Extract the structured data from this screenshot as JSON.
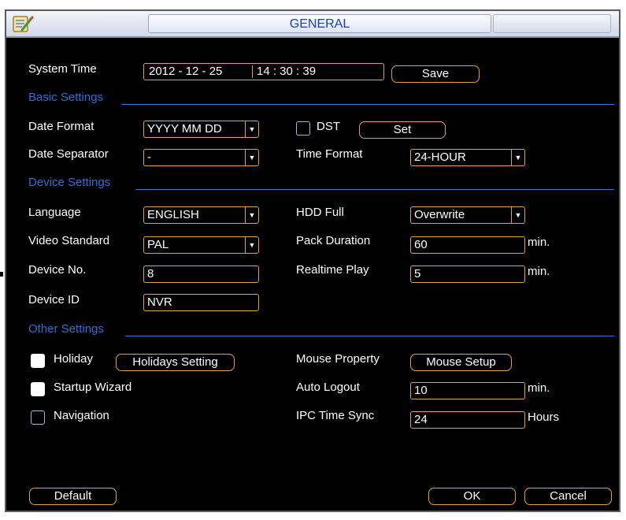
{
  "title": "GENERAL",
  "system_time": {
    "label": "System Time",
    "date_value": "2012  - 12 - 25",
    "time_value": "14 : 30 : 39",
    "save_label": "Save"
  },
  "sections": {
    "basic": "Basic Settings",
    "device": "Device Settings",
    "other": "Other Settings"
  },
  "date_format": {
    "label": "Date Format",
    "value": "YYYY MM DD"
  },
  "dst": {
    "label": "DST",
    "checked": false,
    "set_label": "Set"
  },
  "date_separator": {
    "label": "Date Separator",
    "value": "-"
  },
  "time_format": {
    "label": "Time Format",
    "value": "24-HOUR"
  },
  "language": {
    "label": "Language",
    "value": "ENGLISH"
  },
  "hdd_full": {
    "label": "HDD Full",
    "value": "Overwrite"
  },
  "video_standard": {
    "label": "Video Standard",
    "value": "PAL"
  },
  "pack_duration": {
    "label": "Pack Duration",
    "value": "60",
    "unit": "min."
  },
  "device_no": {
    "label": "Device No.",
    "value": "8"
  },
  "realtime_play": {
    "label": "Realtime Play",
    "value": "5",
    "unit": "min."
  },
  "device_id": {
    "label": "Device ID",
    "value": "NVR"
  },
  "holiday": {
    "label": "Holiday",
    "checked": true,
    "button_label": "Holidays Setting"
  },
  "mouse_property": {
    "label": "Mouse Property",
    "button_label": "Mouse Setup"
  },
  "startup_wizard": {
    "label": "Startup Wizard",
    "checked": true
  },
  "auto_logout": {
    "label": "Auto Logout",
    "value": "10",
    "unit": "min."
  },
  "navigation": {
    "label": "Navigation",
    "checked": false
  },
  "ipc_time_sync": {
    "label": "IPC Time Sync",
    "value": "24",
    "unit": "Hours"
  },
  "footer": {
    "default_label": "Default",
    "ok_label": "OK",
    "cancel_label": "Cancel"
  },
  "colors": {
    "background": "#000000",
    "text": "#ffffff",
    "section": "#2f6fd8",
    "border": "#e2a24a",
    "title": "#1a3fb3"
  },
  "icons": {
    "app": "notepad-pencil-icon",
    "dropdown": "chevron-down-icon"
  }
}
